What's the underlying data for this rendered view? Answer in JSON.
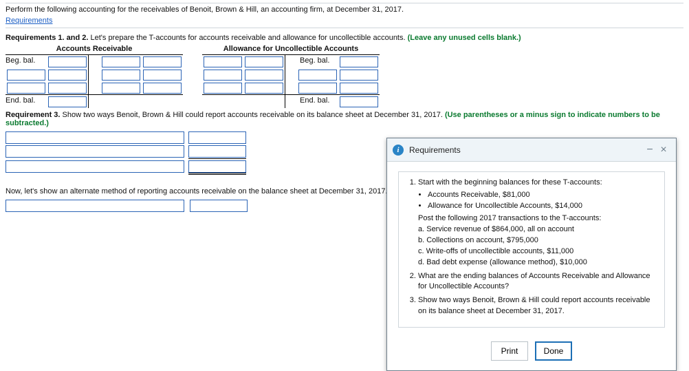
{
  "intro_text": "Perform the following accounting for the receivables of Benoit, Brown & Hill, an accounting firm, at December 31, 2017.",
  "requirements_link": "Requirements",
  "req12": {
    "label": "Requirements 1. and 2.",
    "text": " Let's prepare the T-accounts for accounts receivable and allowance for uncollectible accounts. ",
    "hint": "(Leave any unused cells blank.)"
  },
  "taccounts": {
    "ar_title": "Accounts Receivable",
    "allow_title": "Allowance for Uncollectible Accounts",
    "beg_bal": "Beg. bal.",
    "end_bal": "End. bal."
  },
  "req3": {
    "label": "Requirement 3.",
    "text": " Show two ways Benoit, Brown & Hill could report accounts receivable on its balance sheet at December 31, 2017. ",
    "hint": "(Use parentheses or a minus sign to indicate numbers to be subtracted.)"
  },
  "alt_text": "Now, let's show an alternate method of reporting accounts receivable on the balance sheet at December 31, 2017.",
  "dialog": {
    "title": "Requirements",
    "item1_lead": "Start with the beginning balances for these T-accounts:",
    "bullets": [
      "Accounts Receivable, $81,000",
      "Allowance for Uncollectible Accounts, $14,000"
    ],
    "item1_post": "Post the following 2017 transactions to the T-accounts:",
    "subs": [
      "a. Service revenue of $864,000, all on account",
      "b. Collections on account, $795,000",
      "c. Write-offs of uncollectible accounts, $11,000",
      "d. Bad debt expense (allowance method), $10,000"
    ],
    "item2": "What are the ending balances of Accounts Receivable and Allowance for Uncollectible Accounts?",
    "item3": "Show two ways Benoit, Brown & Hill could report accounts receivable on its balance sheet at December 31, 2017.",
    "print": "Print",
    "done": "Done"
  }
}
